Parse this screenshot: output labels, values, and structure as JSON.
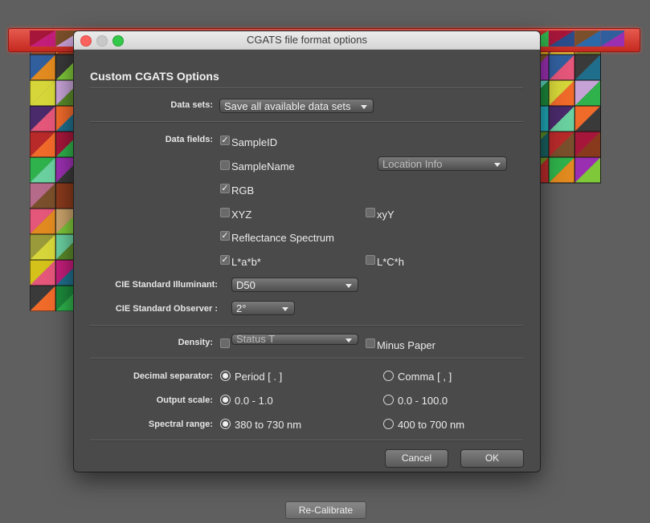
{
  "window": {
    "title": "CGATS file format options"
  },
  "section": {
    "heading": "Custom CGATS Options"
  },
  "data_sets": {
    "label": "Data sets:",
    "value": "Save all available data sets"
  },
  "data_fields": {
    "label": "Data fields:",
    "sample_id": {
      "label": "SampleID",
      "checked": true
    },
    "sample_name": {
      "label": "SampleName",
      "checked": false
    },
    "location_info": "Location Info",
    "rgb": {
      "label": "RGB",
      "checked": true
    },
    "xyz": {
      "label": "XYZ",
      "checked": false
    },
    "xyy": {
      "label": "xyY",
      "checked": false
    },
    "reflectance": {
      "label": "Reflectance Spectrum",
      "checked": true
    },
    "lab": {
      "label": "L*a*b*",
      "checked": true
    },
    "lch": {
      "label": "L*C*h",
      "checked": false
    }
  },
  "illuminant": {
    "label": "CIE Standard Illuminant:",
    "value": "D50"
  },
  "observer": {
    "label": "CIE Standard Observer :",
    "value": "2°"
  },
  "density": {
    "label": "Density:",
    "value": "Status T",
    "minus_paper": "Minus Paper"
  },
  "decimal": {
    "label": "Decimal separator:",
    "opt1": "Period [ . ]",
    "opt2": "Comma [ , ]"
  },
  "scale": {
    "label": "Output scale:",
    "opt1": "0.0 - 1.0",
    "opt2": "0.0 - 100.0"
  },
  "spectral": {
    "label": "Spectral range:",
    "opt1": "380 to 730 nm",
    "opt2": "400 to 700 nm"
  },
  "buttons": {
    "cancel": "Cancel",
    "ok": "OK"
  },
  "background": {
    "recalibrate": "Re-Calibrate"
  },
  "colors": {
    "accent_red": "#d0372c",
    "dialog_bg": "#4a4a4a",
    "page_bg": "#5f5f5f"
  }
}
